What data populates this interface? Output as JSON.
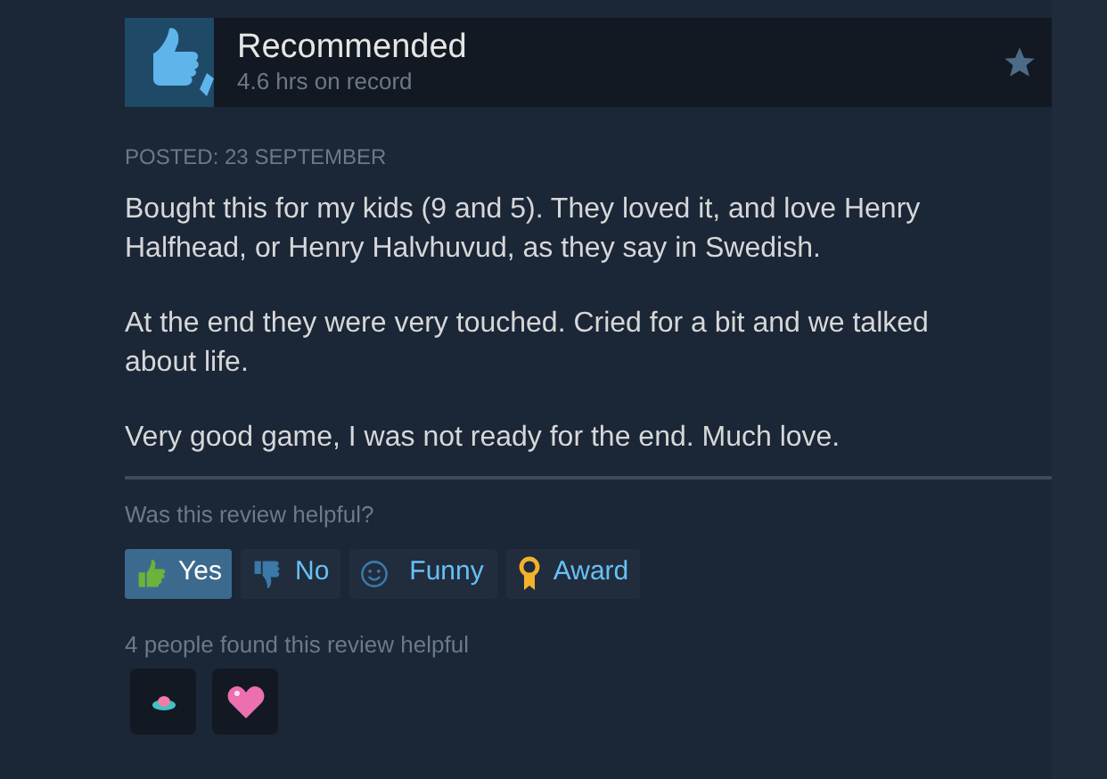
{
  "review": {
    "verdict": "Recommended",
    "hours": "4.6 hrs on record",
    "posted": "POSTED: 23 SEPTEMBER",
    "paragraphs": [
      "Bought this for my kids (9 and 5). They loved it, and love Henry Halfhead, or Henry Halvhuvud, as they say in Swedish.",
      "At the end they were very touched. Cried for a bit and we talked about life.",
      "Very good game, I was not ready for the end. Much love."
    ]
  },
  "helpful": {
    "question": "Was this review helpful?",
    "buttons": [
      {
        "kind": "yes",
        "label": "Yes",
        "selected": true
      },
      {
        "kind": "no",
        "label": "No",
        "selected": false
      },
      {
        "kind": "funny",
        "label": "Funny",
        "selected": false
      },
      {
        "kind": "award",
        "label": "Award",
        "selected": false
      }
    ],
    "count": "4 people found this review helpful",
    "awards": [
      {
        "kind": "saucer"
      },
      {
        "kind": "heart"
      }
    ]
  }
}
